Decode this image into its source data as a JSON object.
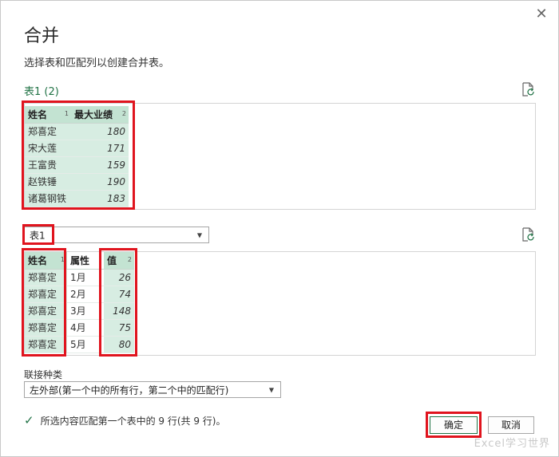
{
  "dialog": {
    "title": "合并",
    "subtitle": "选择表和匹配列以创建合并表。",
    "close_label": "✕"
  },
  "table1": {
    "label": "表1 (2)",
    "headers": [
      {
        "name": "姓名",
        "idx": "1"
      },
      {
        "name": "最大业绩",
        "idx": "2"
      }
    ],
    "rows": [
      [
        "郑喜定",
        "180"
      ],
      [
        "宋大莲",
        "171"
      ],
      [
        "王富贵",
        "159"
      ],
      [
        "赵铁锤",
        "190"
      ],
      [
        "诸葛钢铁",
        "183"
      ]
    ]
  },
  "table2": {
    "selected": "表1",
    "headers": [
      {
        "name": "姓名",
        "idx": "1"
      },
      {
        "name": "属性",
        "idx": ""
      },
      {
        "name": "值",
        "idx": "2"
      }
    ],
    "rows": [
      [
        "郑喜定",
        "1月",
        "26"
      ],
      [
        "郑喜定",
        "2月",
        "74"
      ],
      [
        "郑喜定",
        "3月",
        "148"
      ],
      [
        "郑喜定",
        "4月",
        "75"
      ],
      [
        "郑喜定",
        "5月",
        "80"
      ]
    ]
  },
  "join": {
    "label": "联接种类",
    "selected": "左外部(第一个中的所有行，第二个中的匹配行)"
  },
  "status": {
    "text": "所选内容匹配第一个表中的 9 行(共 9 行)。"
  },
  "buttons": {
    "ok": "确定",
    "cancel": "取消"
  },
  "watermark": "Excel学习世界",
  "colors": {
    "accent": "#217346",
    "highlight": "#e0141e",
    "selected_cell": "#d7ede2"
  }
}
